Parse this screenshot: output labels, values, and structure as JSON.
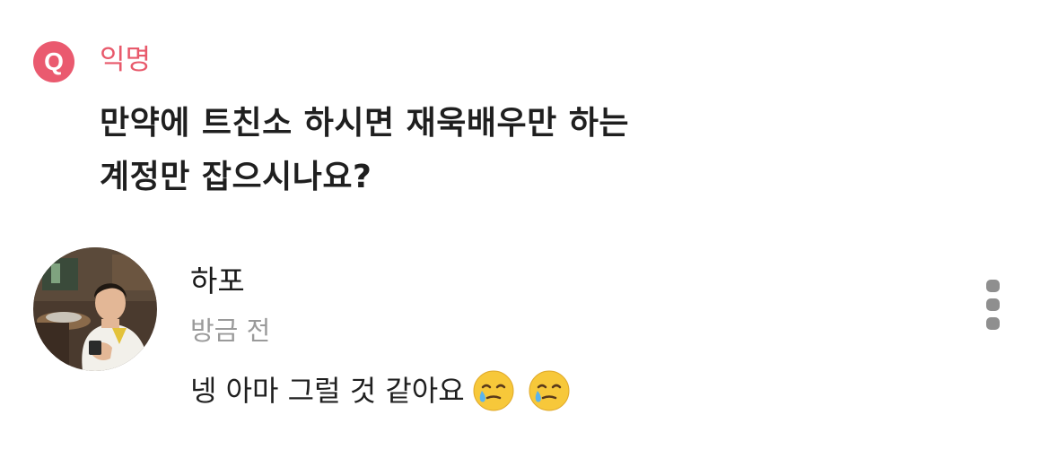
{
  "post": {
    "badge": "Q",
    "author": "익명",
    "question_line1": "만약에 트친소 하시면 재욱배우만 하는",
    "question_line2": "계정만 잡으시나요?"
  },
  "comment": {
    "username": "하포",
    "timestamp": "방금 전",
    "text": "넹 아마 그럴 것 같아요",
    "emojis": [
      "face-holding-back-tears-icon",
      "face-holding-back-tears-icon"
    ],
    "menu_icon": "more-vertical-icon"
  },
  "colors": {
    "accent": "#ea5a6f",
    "muted": "#9a9a9a",
    "menu": "#8f8f8f"
  }
}
